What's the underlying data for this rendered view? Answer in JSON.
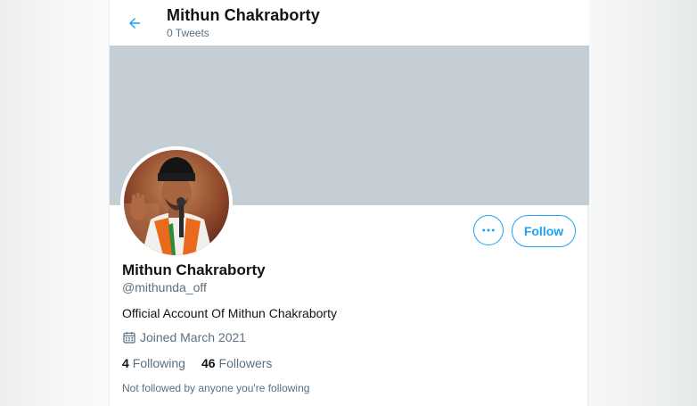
{
  "header": {
    "title": "Mithun Chakraborty",
    "tweet_count": "0 Tweets"
  },
  "profile": {
    "display_name": "Mithun Chakraborty",
    "handle": "@mithunda_off",
    "bio": "Official Account Of Mithun Chakraborty",
    "joined": "Joined March 2021",
    "following_count": "4",
    "following_label": "Following",
    "followers_count": "46",
    "followers_label": "Followers",
    "followed_by_note": "Not followed by anyone you're following"
  },
  "actions": {
    "follow_label": "Follow",
    "more_icon": "ellipsis-icon",
    "back_icon": "arrow-left-icon",
    "calendar_icon": "calendar-icon"
  },
  "colors": {
    "accent": "#1da1f2",
    "banner": "#c5ced5",
    "secondary_text": "#5b7083"
  }
}
